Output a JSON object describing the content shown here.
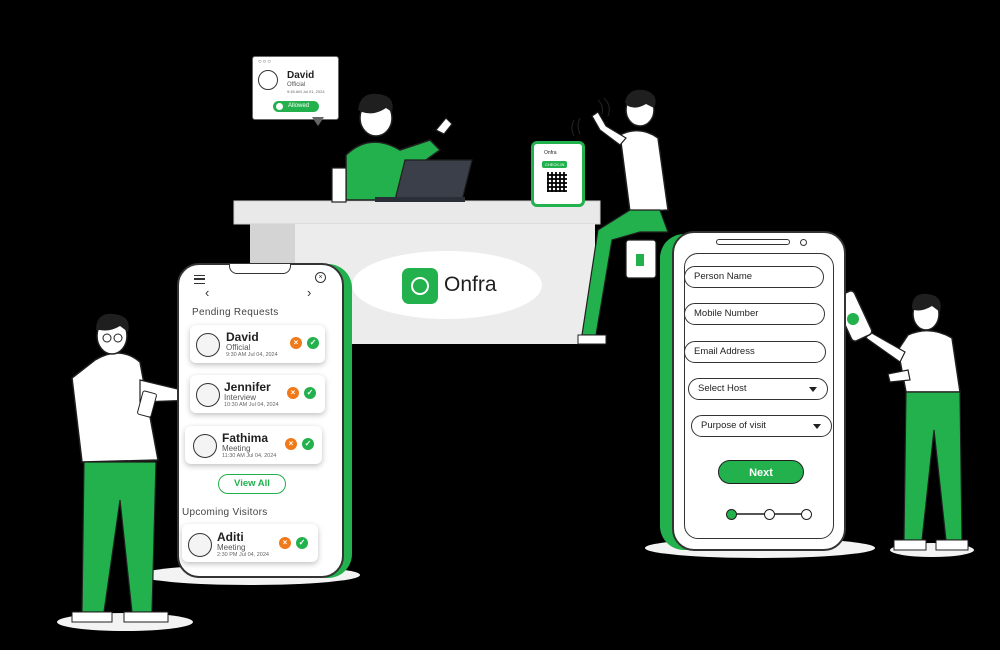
{
  "brand": {
    "name": "Onfra",
    "color": "#22b14c"
  },
  "colors": {
    "accent": "#22b14c",
    "decline": "#f07a1a",
    "desk": "#e6e6e6"
  },
  "notification": {
    "name": "David",
    "role": "Official",
    "time": "9:45 AM Jul 01, 2024",
    "status": "Allowed"
  },
  "kiosk": {
    "brand": "Onfra",
    "badge": "CHECK-IN"
  },
  "requests_phone": {
    "pending_title": "Pending  Requests",
    "requests": [
      {
        "name": "David",
        "purpose": "Official",
        "time": "9:30 AM Jul 04, 2024"
      },
      {
        "name": "Jennifer",
        "purpose": "Interview",
        "time": "10:30 AM Jul 04, 2024"
      },
      {
        "name": "Fathima",
        "purpose": "Meeting",
        "time": "11:30 AM Jul 04, 2024"
      }
    ],
    "view_all_label": "View All",
    "upcoming_title": "Upcoming  Visitors",
    "upcoming": [
      {
        "name": "Aditi",
        "purpose": "Meeting",
        "time": "2:30 PM Jul 04, 2024"
      }
    ],
    "icons": {
      "menu": "menu-icon",
      "close": "close-icon",
      "back": "chevron-left-icon",
      "forward": "chevron-right-icon"
    }
  },
  "form_phone": {
    "fields": {
      "person_name": "Person Name",
      "mobile_number": "Mobile Number",
      "email_address": "Email Address"
    },
    "selects": {
      "host": "Select Host",
      "purpose": "Purpose of visit"
    },
    "next_label": "Next",
    "steps_total": 3,
    "current_step": 1
  }
}
